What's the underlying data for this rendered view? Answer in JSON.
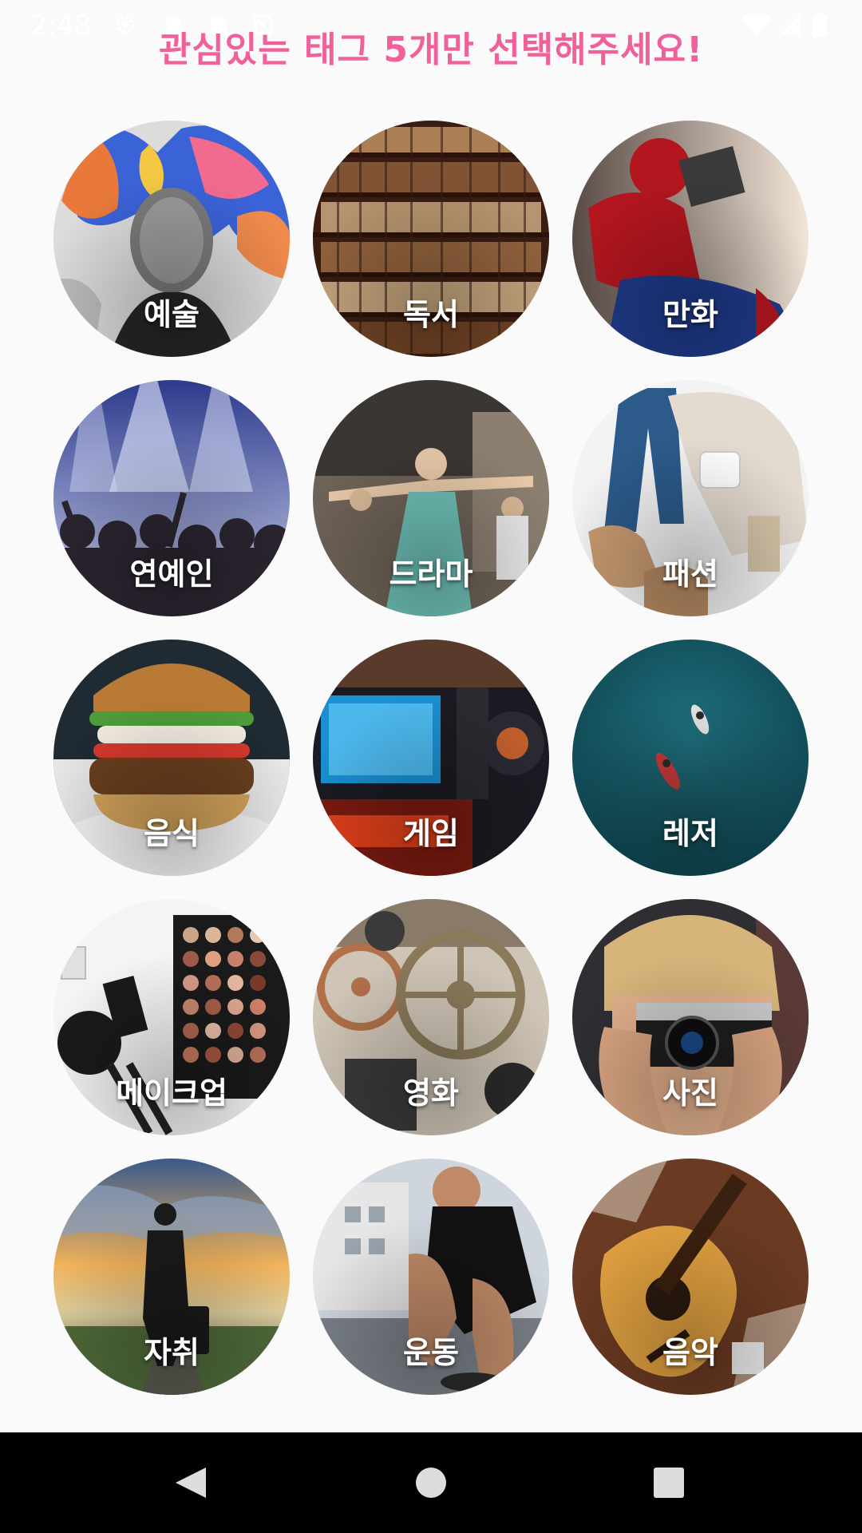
{
  "status_bar": {
    "time": "2:48"
  },
  "header": {
    "title": "관심있는 태그 5개만 선택해주세요!"
  },
  "tags": [
    {
      "label": "예술",
      "icon": "art-mural-image"
    },
    {
      "label": "독서",
      "icon": "bookshelf-image"
    },
    {
      "label": "만화",
      "icon": "spiderman-reading-image"
    },
    {
      "label": "연예인",
      "icon": "concert-crowd-image"
    },
    {
      "label": "드라마",
      "icon": "dancer-image"
    },
    {
      "label": "패션",
      "icon": "clothes-flatlay-image"
    },
    {
      "label": "음식",
      "icon": "burger-image"
    },
    {
      "label": "게임",
      "icon": "gamer-screen-image"
    },
    {
      "label": "레저",
      "icon": "surfers-ocean-image"
    },
    {
      "label": "메이크업",
      "icon": "makeup-palette-image"
    },
    {
      "label": "영화",
      "icon": "film-reels-image"
    },
    {
      "label": "사진",
      "icon": "camera-photographer-image"
    },
    {
      "label": "자취",
      "icon": "traveler-suitcase-image"
    },
    {
      "label": "운동",
      "icon": "runner-tying-shoe-image"
    },
    {
      "label": "음악",
      "icon": "guitar-image"
    }
  ],
  "colors": {
    "title": "#f0609a",
    "background": "#fafafa",
    "nav_bar": "#000000"
  },
  "nav": {
    "back": "back-icon",
    "home": "home-icon",
    "recents": "recents-icon"
  }
}
